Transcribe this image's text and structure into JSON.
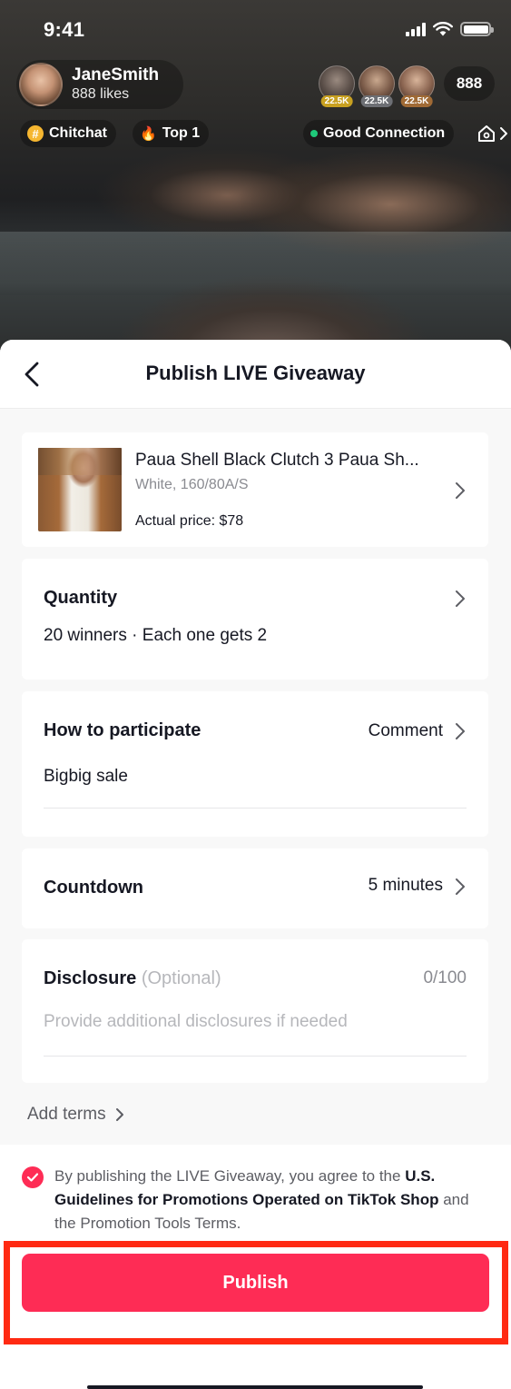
{
  "status_bar": {
    "time": "9:41"
  },
  "host": {
    "name": "JaneSmith",
    "likes": "888 likes"
  },
  "viewers": {
    "badges": [
      "22.5K",
      "22.5K",
      "22.5K"
    ],
    "count": "888"
  },
  "tags": {
    "chitchat": "Chitchat",
    "top": "Top 1",
    "connection": "Good Connection"
  },
  "sheet": {
    "title": "Publish LIVE Giveaway"
  },
  "product": {
    "name": "Paua Shell Black Clutch 3 Paua Sh...",
    "variant": "White, 160/80A/S",
    "price": "Actual price: $78"
  },
  "quantity": {
    "label": "Quantity",
    "value": "20 winners · Each one gets 2"
  },
  "participate": {
    "label": "How to participate",
    "method": "Comment",
    "keyword": "Bigbig sale"
  },
  "countdown": {
    "label": "Countdown",
    "value": "5 minutes"
  },
  "disclosure": {
    "label": "Disclosure",
    "optional": "(Optional)",
    "counter": "0/100",
    "placeholder": "Provide additional disclosures if needed"
  },
  "add_terms": "Add terms",
  "agreement": {
    "prefix": "By publishing the LIVE Giveaway, you agree to the ",
    "link": "U.S. Guidelines for Promotions Operated on TikTok Shop",
    "suffix": " and the Promotion Tools Terms.",
    "checked": true
  },
  "publish_label": "Publish",
  "colors": {
    "accent": "#fe2c55",
    "highlight": "#ff2a12",
    "connection": "#1fc97a"
  }
}
